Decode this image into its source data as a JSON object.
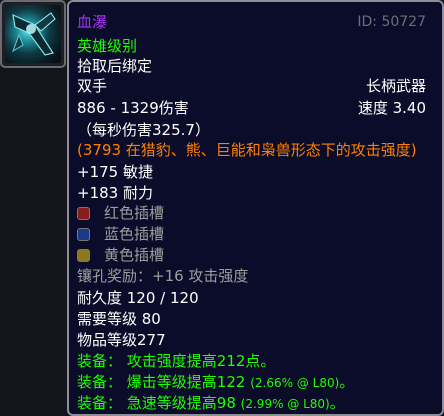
{
  "item": {
    "name": "血瀑",
    "id_label": "ID: 50727",
    "quality": "英雄级别",
    "bind": "拾取后绑定",
    "slot": "双手",
    "type": "长柄武器",
    "damage": "886 - 1329伤害",
    "speed": "速度 3.40",
    "dps": "（每秒伤害325.7）",
    "feral_ap": "(3793 在猎豹、熊、巨能和枭兽形态下的攻击强度)",
    "stats": [
      "+175 敏捷",
      "+183 耐力"
    ],
    "sockets": [
      {
        "label": "红色插槽",
        "color": "#8a1c1c"
      },
      {
        "label": "蓝色插槽",
        "color": "#1c3a8a"
      },
      {
        "label": "黄色插槽",
        "color": "#8a7a1c"
      }
    ],
    "socket_bonus": "镶孔奖励：+16 攻击强度",
    "durability": "耐久度 120 / 120",
    "required_level": "需要等级 80",
    "item_level": "物品等级277",
    "equip": [
      {
        "prefix": "装备：",
        "text": "攻击强度提高212点。",
        "extra": ""
      },
      {
        "prefix": "装备：",
        "text": "爆击等级提高122",
        "extra": "(2.66% @ L80)",
        "tail": "。"
      },
      {
        "prefix": "装备：",
        "text": "急速等级提高98",
        "extra": "(2.99% @ L80)",
        "tail": "。"
      }
    ]
  },
  "icon": "weapon-icon",
  "colors": {
    "epic": "#a335ee",
    "uncommon": "#1eff00",
    "orange": "#ff8000",
    "gray": "#9d9d9d"
  }
}
